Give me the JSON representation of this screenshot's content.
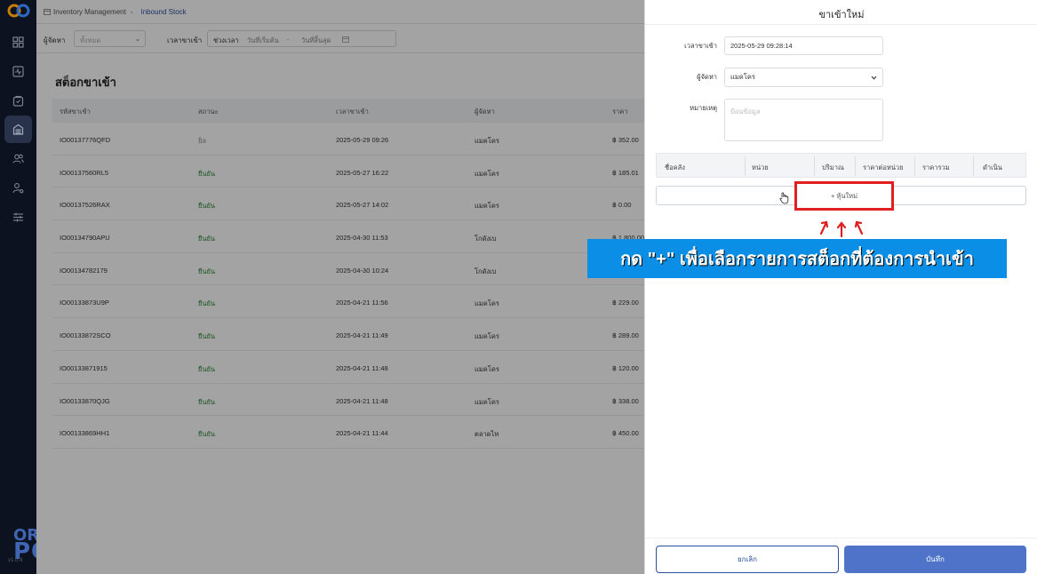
{
  "breadcrumb": {
    "parent": "Inventory Management",
    "current": "Inbound Stock"
  },
  "filters": {
    "supplier_label": "ผู้จัดหา",
    "supplier_placeholder": "ทั้งหมด",
    "time_label": "เวลาขาเข้า",
    "range_label": "ช่วงเวลา",
    "start_placeholder": "วันที่เริ่มต้น",
    "dash": "-",
    "end_placeholder": "วันที่สิ้นสุด"
  },
  "page_title": "สต็อกขาเข้า",
  "table": {
    "headers": [
      "รหัสขาเข้า",
      "สถานะ",
      "เวลาขาเข้า",
      "ผู้จัดหา",
      "ราคา"
    ],
    "rows": [
      {
        "id": "IO00137776QFD",
        "status": "ยิล",
        "status_type": "cancel",
        "time": "2025-05-29 09:26",
        "supplier": "แมคโคร",
        "price": "฿ 352.00"
      },
      {
        "id": "IO00137560RL5",
        "status": "ยืนยัน",
        "status_type": "ok",
        "time": "2025-05-27 16:22",
        "supplier": "แมคโคร",
        "price": "฿ 185.01"
      },
      {
        "id": "IO00137526RAX",
        "status": "ยืนยัน",
        "status_type": "ok",
        "time": "2025-05-27 14:02",
        "supplier": "แมคโคร",
        "price": "฿ 0.00"
      },
      {
        "id": "IO00134790APU",
        "status": "ยืนยัน",
        "status_type": "ok",
        "time": "2025-04-30 11:53",
        "supplier": "โกดังเบ",
        "price": "฿ 1,800.00"
      },
      {
        "id": "IO00134782179",
        "status": "ยืนยัน",
        "status_type": "ok",
        "time": "2025-04-30 10:24",
        "supplier": "โกดังเบ",
        "price": ""
      },
      {
        "id": "IO00133873U9P",
        "status": "ยืนยัน",
        "status_type": "ok",
        "time": "2025-04-21 11:56",
        "supplier": "แมคโคร",
        "price": "฿ 229.00"
      },
      {
        "id": "IO00133872SCO",
        "status": "ยืนยัน",
        "status_type": "ok",
        "time": "2025-04-21 11:49",
        "supplier": "แมคโคร",
        "price": "฿ 289.00"
      },
      {
        "id": "IO00133871915",
        "status": "ยืนยัน",
        "status_type": "ok",
        "time": "2025-04-21 11:48",
        "supplier": "แมคโคร",
        "price": "฿ 120.00"
      },
      {
        "id": "IO00133870QJG",
        "status": "ยืนยัน",
        "status_type": "ok",
        "time": "2025-04-21 11:48",
        "supplier": "แมคโคร",
        "price": "฿ 338.00"
      },
      {
        "id": "IO00133869HH1",
        "status": "ยืนยัน",
        "status_type": "ok",
        "time": "2025-04-21 11:44",
        "supplier": "ตลาดไท",
        "price": "฿ 450.00"
      }
    ]
  },
  "brand": {
    "line1": "ORDER",
    "line2": "POS",
    "version": "v1.0.4"
  },
  "drawer": {
    "title": "ขาเข้าใหม่",
    "time_label": "เวลาขาเข้า",
    "time_value": "2025-05-29 09:28:14",
    "supplier_label": "ผู้จัดหา",
    "supplier_value": "แมคโคร",
    "note_label": "หมายเหตุ",
    "note_placeholder": "ป้อนข้อมูล",
    "item_headers": [
      "ชื่อคลัง",
      "หน่วย",
      "ปริมาณ",
      "ราคาต่อหน่วย",
      "ราคารวม",
      "ดำเนิน"
    ],
    "add_item_label": "+ หุ้นใหม่",
    "cancel_label": "ยกเลิก",
    "save_label": "บันทึก"
  },
  "callout_text": "กด \"+\" เพื่อเลือกรายการสต็อกที่ต้องการนำเข้า",
  "colors": {
    "rail": "#0f1729",
    "accent": "#4f73c8",
    "highlight": "#e02020",
    "callout": "#0b8fe6",
    "status_ok": "#2e8b3a"
  }
}
